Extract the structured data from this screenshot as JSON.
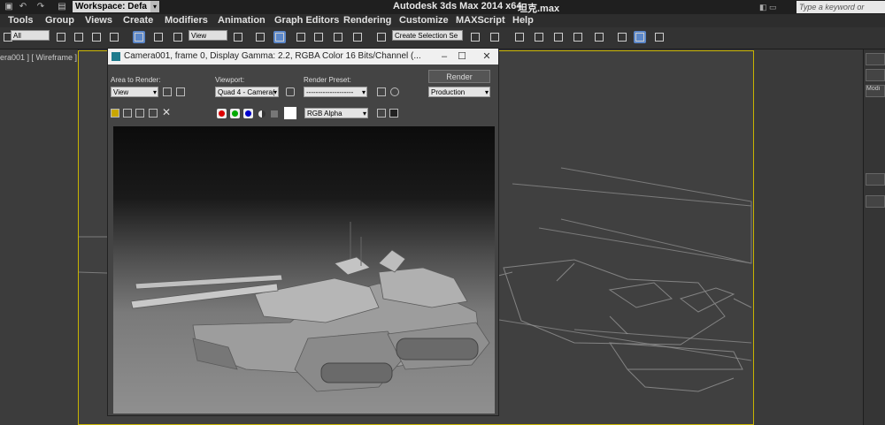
{
  "titlebar": {
    "workspace": "Workspace: Defa",
    "app_title": "Autodesk 3ds Max  2014 x64",
    "file_name": "坦克.max",
    "search_placeholder": "Type a keyword or phrase"
  },
  "menu": [
    "Tools",
    "Group",
    "Views",
    "Create",
    "Modifiers",
    "Animation",
    "Graph Editors",
    "Rendering",
    "Customize",
    "MAXScript",
    "Help"
  ],
  "toolbar": {
    "filter_select": "All",
    "view_select": "View",
    "selection_set": "Create Selection Se"
  },
  "viewport": {
    "label": "era001 ] [ Wireframe ]"
  },
  "render_window": {
    "title": "Camera001, frame 0, Display Gamma: 2.2, RGBA Color 16 Bits/Channel (...",
    "area_label": "Area to Render:",
    "area_value": "View",
    "viewport_label": "Viewport:",
    "viewport_value": "Quad 4 - Camera(",
    "preset_label": "Render Preset:",
    "preset_value": "--------------------",
    "render_button": "Render",
    "mode_value": "Production",
    "channel_value": "RGB Alpha"
  },
  "command_panel": {
    "tab": "Modi"
  },
  "colors": {
    "accent": "#5b87c9",
    "viewport_border": "#c8b400",
    "logo": "#1d7a8c"
  }
}
